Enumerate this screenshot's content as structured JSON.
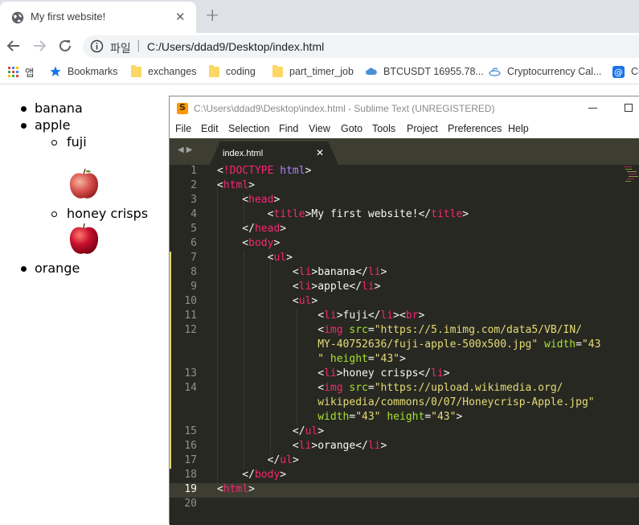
{
  "browser": {
    "tab_title": "My first website!",
    "omnibox_prefix": "파일",
    "url": "C:/Users/ddad9/Desktop/index.html",
    "bookmarks": [
      {
        "label": "앱",
        "icon": "apps-grid-icon"
      },
      {
        "label": "Bookmarks",
        "icon": "star-icon"
      },
      {
        "label": "exchanges",
        "icon": "folder-icon"
      },
      {
        "label": "coding",
        "icon": "folder-icon"
      },
      {
        "label": "part_timer_job",
        "icon": "folder-icon"
      },
      {
        "label": "BTCUSDT 16955.78...",
        "icon": "cloud-icon"
      },
      {
        "label": "Cryptocurrency Cal...",
        "icon": "currency-icon"
      },
      {
        "label": "Cr",
        "icon": "at-icon"
      }
    ]
  },
  "webpage": {
    "items": [
      "banana",
      "apple",
      "orange"
    ],
    "sub_items": [
      "fuji",
      "honey crisps"
    ]
  },
  "sublime": {
    "window_title": "C:\\Users\\ddad9\\Desktop\\index.html - Sublime Text (UNREGISTERED)",
    "menu": [
      "File",
      "Edit",
      "Selection",
      "Find",
      "View",
      "Goto",
      "Tools",
      "Project",
      "Preferences",
      "Help"
    ],
    "tab_name": "index.html",
    "line_numbers": [
      "1",
      "2",
      "3",
      "4",
      "5",
      "6",
      "7",
      "8",
      "9",
      "10",
      "11",
      "12",
      "13",
      "14",
      "15",
      "16",
      "17",
      "18",
      "19",
      "20"
    ],
    "code": {
      "l1_kw": "!DOCTYPE",
      "l1_kw2": "html",
      "tag_html": "html",
      "tag_head": "head",
      "tag_title": "title",
      "tag_body": "body",
      "tag_ul": "ul",
      "tag_li": "li",
      "tag_br": "br",
      "tag_img": "img",
      "title_text": "My first website!",
      "li_banana": "banana",
      "li_apple": "apple",
      "li_fuji": "fuji",
      "li_honey": "honey crisps",
      "li_orange": "orange",
      "attr_src": "src",
      "attr_width": "width",
      "attr_height": "height",
      "img1_src_a": "\"https://5.imimg.com/data5/VB/IN/",
      "img1_src_b": "MY-40752636/fuji-apple-500x500.jpg\"",
      "img1_w_open": "\"43",
      "img1_w_close": "\"",
      "img2_src_a": "\"https://upload.wikimedia.org/",
      "img2_src_b": "wikipedia/commons/0/07/Honeycrisp-Apple.jpg\"",
      "val_43": "\"43\""
    }
  }
}
